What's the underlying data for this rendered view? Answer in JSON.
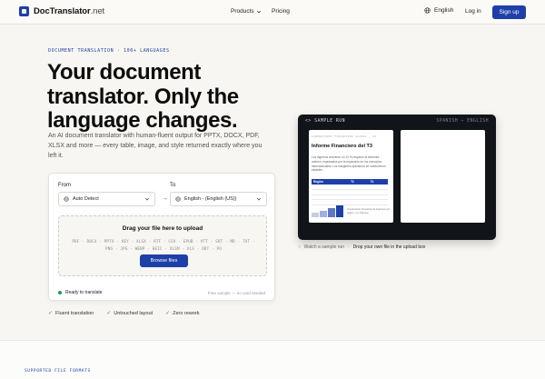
{
  "header": {
    "logo_name": "DocTranslator",
    "logo_tld": ".net",
    "nav_products": "Products",
    "nav_pricing": "Pricing",
    "language": "English",
    "login": "Log in",
    "signup": "Sign up"
  },
  "hero": {
    "eyebrow": "DOCUMENT TRANSLATION · 100+ LANGUAGES",
    "title": "Your document translator. Only the language changes.",
    "subtitle": "An AI document translator with human-fluent output for PPTX, DOCX, PDF, XLSX and more — every table, image, and style returned exactly where you left it."
  },
  "translator": {
    "from_label": "From",
    "to_label": "To",
    "from_value": "Auto Detect",
    "to_value": "English - (English (US))",
    "drop_title": "Drag your file here to upload",
    "formats_line1": "PDF · DOCX · PPTX · KEY · XLSX · RTF · CSV · EPUB · VTT · SRT · MD · TXT ·",
    "formats_line2": "PNG · JPG · WEBP · HEIC · XLSM · XLS · ODT · PO",
    "browse": "Browse files",
    "status": "Ready to translate",
    "status_note": "Free sample — no card needed"
  },
  "features": [
    "Fluent translation",
    "Untouched layout",
    "Zero rework"
  ],
  "sample": {
    "header": "SAMPLE RUN",
    "langs": "SPANISH → ENGLISH",
    "doc_kicker": "LABORATORIO FINANCIERO GLOBAL · Q3",
    "doc_title": "Informe Financiero del T3",
    "doc_body": "Los ingresos crecieron un 12 % respecto al trimestre anterior, impulsados por la expansión en los mercados internacionales. Los márgenes operativos se mantuvieron estables.",
    "table_headers": [
      "Región",
      "T2",
      "T3"
    ],
    "table_rows": [
      [
        "",
        "",
        ""
      ],
      [
        "",
        "",
        ""
      ],
      [
        "",
        "",
        ""
      ],
      [
        "",
        "",
        ""
      ]
    ],
    "legend": "Crecimiento trimestral de ingresos por región, en millones.",
    "caption_prefix": "Watch a sample run",
    "caption_strong": "Drop your own file in the upload box"
  },
  "footer": {
    "supported": "SUPPORTED FILE FORMATS"
  },
  "colors": {
    "accent": "#1d3fa8",
    "success": "#1f9d55",
    "dark_panel": "#111418"
  }
}
